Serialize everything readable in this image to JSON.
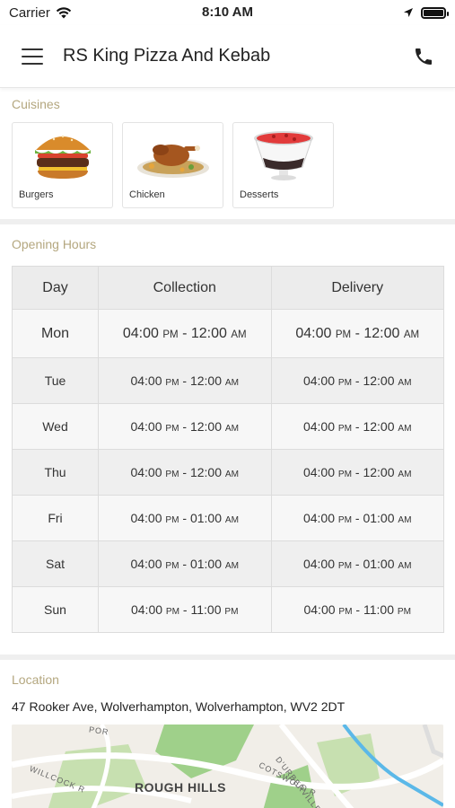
{
  "status_bar": {
    "carrier": "Carrier",
    "time": "8:10 AM"
  },
  "header": {
    "title": "RS King Pizza And Kebab"
  },
  "cuisines": {
    "title": "Cuisines",
    "items": [
      {
        "label": "Burgers",
        "icon": "burger-icon"
      },
      {
        "label": "Chicken",
        "icon": "chicken-icon"
      },
      {
        "label": "Desserts",
        "icon": "dessert-icon"
      }
    ]
  },
  "opening_hours": {
    "title": "Opening Hours",
    "columns": [
      "Day",
      "Collection",
      "Delivery"
    ],
    "am": "AM",
    "pm": "PM",
    "rows": [
      {
        "day": "Mon",
        "collection_open": "04:00",
        "collection_close": "12:00",
        "delivery_open": "04:00",
        "delivery_close": "12:00",
        "close_period": "AM"
      },
      {
        "day": "Tue",
        "collection_open": "04:00",
        "collection_close": "12:00",
        "delivery_open": "04:00",
        "delivery_close": "12:00",
        "close_period": "AM"
      },
      {
        "day": "Wed",
        "collection_open": "04:00",
        "collection_close": "12:00",
        "delivery_open": "04:00",
        "delivery_close": "12:00",
        "close_period": "AM"
      },
      {
        "day": "Thu",
        "collection_open": "04:00",
        "collection_close": "12:00",
        "delivery_open": "04:00",
        "delivery_close": "12:00",
        "close_period": "AM"
      },
      {
        "day": "Fri",
        "collection_open": "04:00",
        "collection_close": "01:00",
        "delivery_open": "04:00",
        "delivery_close": "01:00",
        "close_period": "AM"
      },
      {
        "day": "Sat",
        "collection_open": "04:00",
        "collection_close": "01:00",
        "delivery_open": "04:00",
        "delivery_close": "01:00",
        "close_period": "AM"
      },
      {
        "day": "Sun",
        "collection_open": "04:00",
        "collection_close": "11:00",
        "delivery_open": "04:00",
        "delivery_close": "11:00",
        "close_period": "PM"
      }
    ]
  },
  "location": {
    "title": "Location",
    "address": "47 Rooker Ave, Wolverhampton, Wolverhampton, WV2 2DT",
    "map_labels": {
      "area": "ROUGH HILLS",
      "street_1": "WILLCOCK R",
      "street_2": "COTSWOLD R",
      "street_3": "D'URBERVILLE ROAD",
      "street_4": "POR"
    }
  },
  "colors": {
    "accent": "#b4a77f",
    "divider": "#efefef"
  }
}
